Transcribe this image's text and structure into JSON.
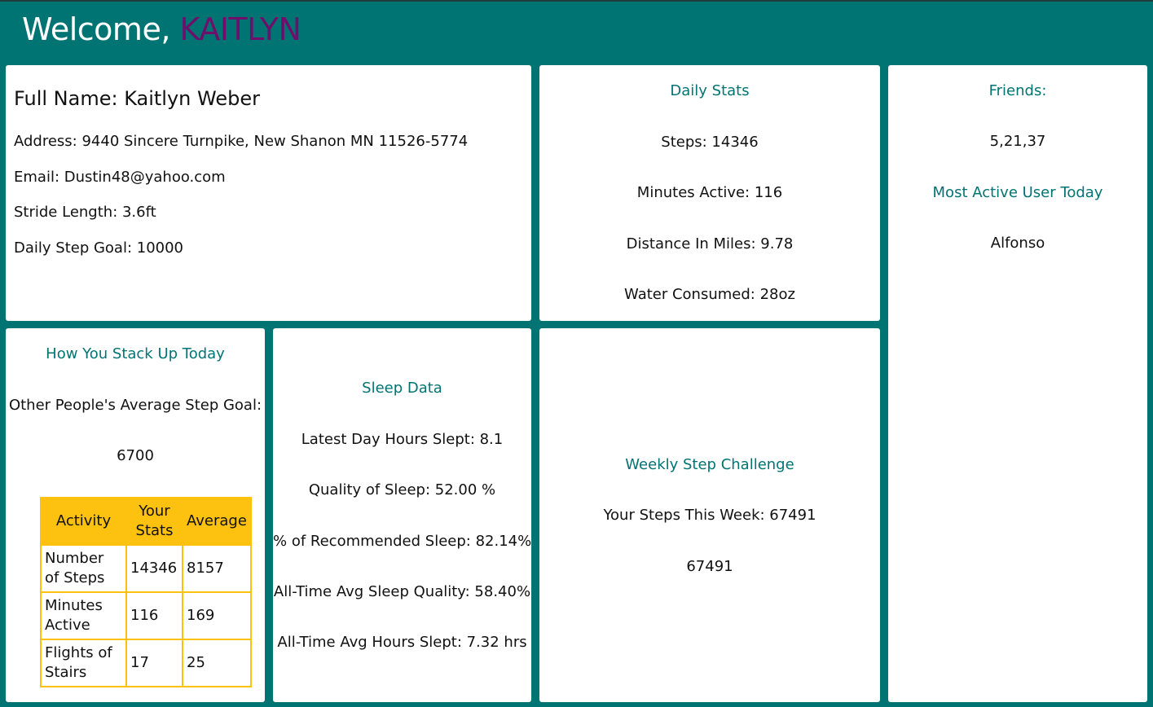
{
  "header": {
    "welcome": "Welcome,",
    "user_name": "KAITLYN"
  },
  "profile": {
    "full_name": "Full Name: Kaitlyn Weber",
    "address": "Address: 9440 Sincere Turnpike, New Shanon MN 11526-5774",
    "email": "Email: Dustin48@yahoo.com",
    "stride": "Stride Length: 3.6ft",
    "step_goal": "Daily Step Goal: 10000"
  },
  "daily_stats": {
    "title": "Daily Stats",
    "steps": "Steps: 14346",
    "minutes_active": "Minutes Active: 116",
    "distance": "Distance In Miles: 9.78",
    "water": "Water Consumed: 28oz"
  },
  "friends": {
    "title": "Friends:",
    "ids": "5,21,37",
    "most_active_title": "Most Active User Today",
    "most_active_name": "Alfonso"
  },
  "stack_up": {
    "title": "How You Stack Up Today",
    "avg_goal_label": "Other People's Average Step Goal:",
    "avg_goal_value": "6700",
    "table": {
      "headers": [
        "Activity",
        "Your Stats",
        "Average"
      ],
      "rows": [
        [
          "Number of Steps",
          "14346",
          "8157"
        ],
        [
          "Minutes Active",
          "116",
          "169"
        ],
        [
          "Flights of Stairs",
          "17",
          "25"
        ]
      ]
    }
  },
  "sleep": {
    "title": "Sleep Data",
    "latest_hours": "Latest Day Hours Slept: 8.1",
    "quality": "Quality of Sleep: 52.00 %",
    "recommended": "% of Recommended Sleep: 82.14%",
    "avg_quality": "All-Time Avg Sleep Quality: 58.40%",
    "avg_hours": "All-Time Avg Hours Slept: 7.32 hrs"
  },
  "weekly": {
    "title": "Weekly Step Challenge",
    "your_steps": "Your Steps This Week: 67491",
    "total": "67491"
  },
  "colors": {
    "background": "#007472",
    "accent_name": "#6e0f6c",
    "heading": "#007472",
    "table_header": "#fdc10f"
  }
}
